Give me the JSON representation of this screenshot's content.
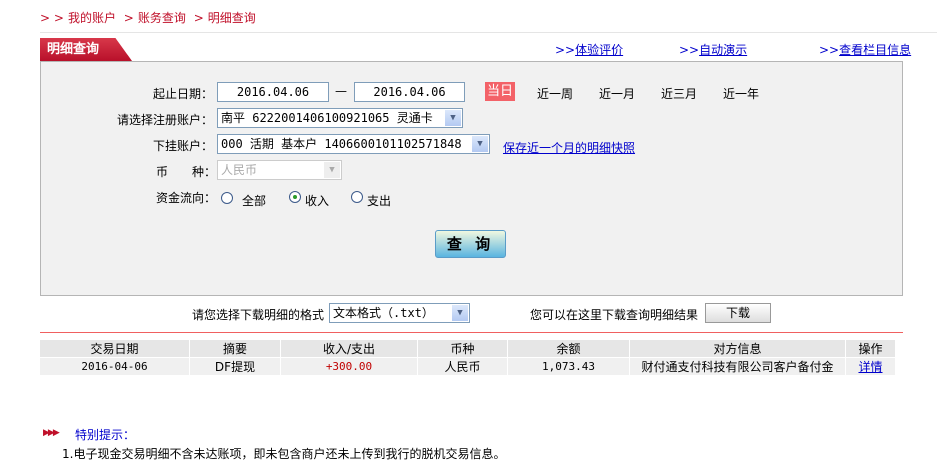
{
  "breadcrumb": {
    "items": [
      "我的账户",
      "账务查询",
      "明细查询"
    ]
  },
  "tab": {
    "title": "明细查询"
  },
  "top_links": [
    "体验评价",
    "自动演示",
    "查看栏目信息"
  ],
  "form": {
    "date_label": "起止日期：",
    "start_date": "2016.04.06",
    "date_sep": "—",
    "end_date": "2016.04.06",
    "quick": {
      "today": "当日",
      "options": [
        "近一周",
        "近一月",
        "近三月",
        "近一年"
      ]
    },
    "account_label": "请选择注册账户：",
    "account_value": "南平 6222001406100921065 灵通卡",
    "sub_label": "下挂账户：",
    "sub_value": "000 活期 基本户 1406600101102571848",
    "snapshot_link": "保存近一个月的明细快照",
    "currency_label": "币　　种：",
    "currency_value": "人民币",
    "flow_label": "资金流向：",
    "flow_options": [
      "全部",
      "收入",
      "支出"
    ],
    "flow_selected": "收入",
    "query_button": "查 询"
  },
  "download": {
    "label": "请您选择下载明细的格式",
    "format": "文本格式（.txt）",
    "hint": "您可以在这里下载查询明细结果",
    "button": "下载"
  },
  "table": {
    "headers": [
      "交易日期",
      "摘要",
      "收入/支出",
      "币种",
      "余额",
      "对方信息",
      "操作"
    ],
    "rows": [
      [
        "2016-04-06",
        "DF提现",
        "+300.00",
        "人民币",
        "1,073.43",
        "财付通支付科技有限公司客户备付金",
        "详情"
      ]
    ]
  },
  "notes": {
    "title": "特别提示：",
    "items": [
      "1.电子现金交易明细不含未达账项，即未包含商户还未上传到我行的脱机交易信息。"
    ]
  },
  "colors": {
    "brand": "#c0102a",
    "today": "#f36268",
    "amount": "#c00000",
    "link": "#0000cc"
  }
}
